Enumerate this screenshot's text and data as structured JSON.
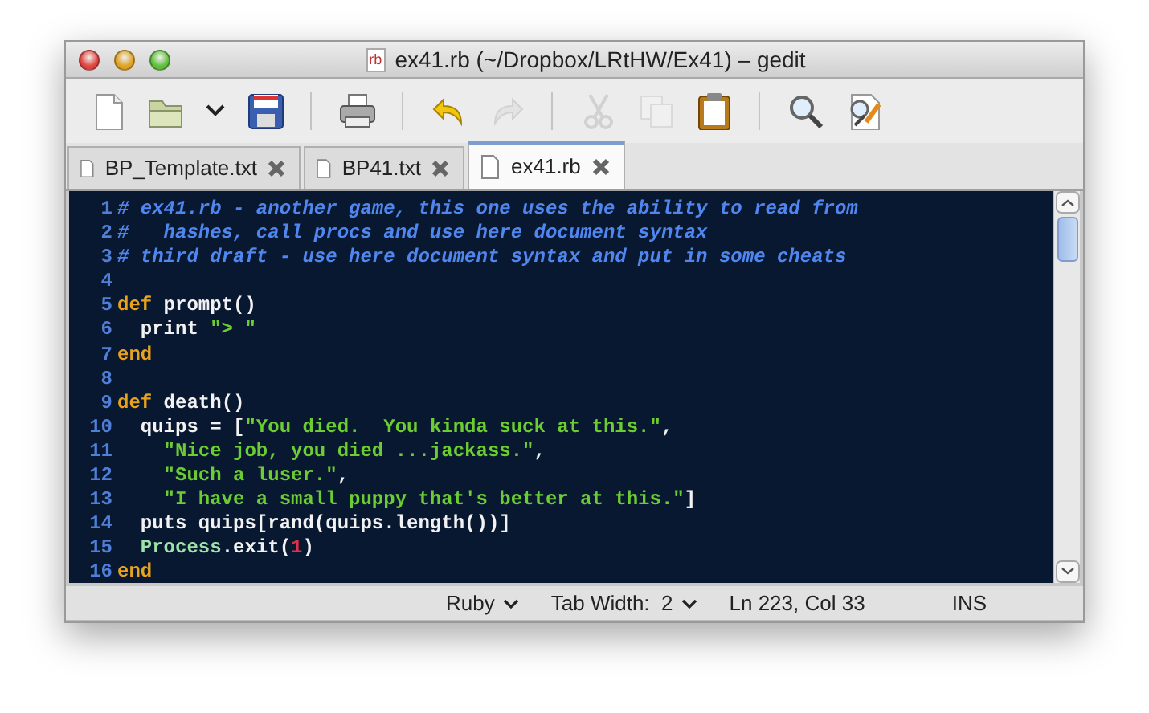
{
  "window": {
    "title": "ex41.rb (~/Dropbox/LRtHW/Ex41) – gedit",
    "file_icon_text": "rb"
  },
  "toolbar": [
    {
      "kind": "new",
      "disabled": false
    },
    {
      "kind": "open",
      "disabled": false
    },
    {
      "kind": "caret",
      "disabled": false
    },
    {
      "kind": "save",
      "disabled": false
    },
    {
      "kind": "separator"
    },
    {
      "kind": "print",
      "disabled": false
    },
    {
      "kind": "separator"
    },
    {
      "kind": "undo",
      "disabled": false
    },
    {
      "kind": "redo",
      "disabled": true
    },
    {
      "kind": "separator"
    },
    {
      "kind": "cut",
      "disabled": true
    },
    {
      "kind": "copy",
      "disabled": true
    },
    {
      "kind": "paste",
      "disabled": false
    },
    {
      "kind": "separator"
    },
    {
      "kind": "find",
      "disabled": false
    },
    {
      "kind": "replace",
      "disabled": false
    }
  ],
  "tabs": [
    {
      "label": "BP_Template.txt",
      "selected": false
    },
    {
      "label": "BP41.txt",
      "selected": false
    },
    {
      "label": "ex41.rb",
      "selected": true
    }
  ],
  "editor": {
    "lines": [
      {
        "number": "1",
        "tokens": [
          {
            "kind": "comment",
            "text": "# ex41.rb - another game, this one uses the ability to read from"
          }
        ]
      },
      {
        "number": "2",
        "tokens": [
          {
            "kind": "comment",
            "text": "#   hashes, call procs and use here document syntax"
          }
        ]
      },
      {
        "number": "3",
        "tokens": [
          {
            "kind": "comment",
            "text": "# third draft - use here document syntax and put in some cheats"
          }
        ]
      },
      {
        "number": "4"
      },
      {
        "number": "5",
        "tokens": [
          {
            "kind": "keyword",
            "text": "def"
          },
          {
            "kind": "plain",
            "text": " prompt()"
          }
        ]
      },
      {
        "number": "6",
        "tokens": [
          {
            "kind": "plain",
            "text": "  print "
          },
          {
            "kind": "string",
            "text": "\"> \""
          }
        ]
      },
      {
        "number": "7",
        "tokens": [
          {
            "kind": "keyword",
            "text": "end"
          }
        ]
      },
      {
        "number": "8"
      },
      {
        "number": "9",
        "tokens": [
          {
            "kind": "keyword",
            "text": "def"
          },
          {
            "kind": "plain",
            "text": " death()"
          }
        ]
      },
      {
        "number": "10",
        "tokens": [
          {
            "kind": "plain",
            "text": "  quips = ["
          },
          {
            "kind": "string",
            "text": "\"You died.  You kinda suck at this.\""
          },
          {
            "kind": "plain",
            "text": ","
          }
        ]
      },
      {
        "number": "11",
        "tokens": [
          {
            "kind": "string",
            "text": "    \"Nice job, you died ...jackass.\""
          },
          {
            "kind": "plain",
            "text": ","
          }
        ]
      },
      {
        "number": "12",
        "tokens": [
          {
            "kind": "string",
            "text": "    \"Such a luser.\""
          },
          {
            "kind": "plain",
            "text": ","
          }
        ]
      },
      {
        "number": "13",
        "tokens": [
          {
            "kind": "string",
            "text": "    \"I have a small puppy that's better at this.\""
          },
          {
            "kind": "plain",
            "text": "]"
          }
        ]
      },
      {
        "number": "14",
        "tokens": [
          {
            "kind": "plain",
            "text": "  puts quips[rand(quips.length())]"
          }
        ]
      },
      {
        "number": "15",
        "tokens": [
          {
            "kind": "constant",
            "text": "  Process"
          },
          {
            "kind": "plain",
            "text": ".exit("
          },
          {
            "kind": "number",
            "text": "1"
          },
          {
            "kind": "plain",
            "text": ")"
          }
        ]
      },
      {
        "number": "16",
        "tokens": [
          {
            "kind": "keyword",
            "text": "end"
          }
        ]
      }
    ]
  },
  "status_bar": {
    "language": "Ruby",
    "tab_width": "Tab Width:  2",
    "position": "Ln 223, Col 33",
    "mode": "INS"
  }
}
